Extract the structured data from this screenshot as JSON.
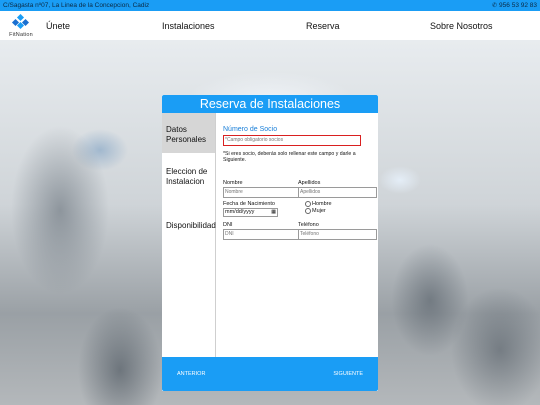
{
  "topbar": {
    "address": "C/Sagasta nº07, La Linea de la Concepcion, Cadiz",
    "phone": "956 53 92 83",
    "phone_icon": "phone-icon"
  },
  "brand": {
    "name": "FitNation",
    "logo_icon": "fitnation-logo-icon"
  },
  "nav": {
    "items": [
      "Únete",
      "Instalaciones",
      "Reserva",
      "Sobre Nosotros"
    ]
  },
  "card": {
    "title": "Reserva de Instalaciones",
    "steps": [
      {
        "label": "Datos Personales",
        "active": true
      },
      {
        "label": "Eleccion de Instalacion",
        "active": false
      },
      {
        "label": "Disponibilidad",
        "active": false
      }
    ],
    "form": {
      "socio_label": "Número de Socio",
      "socio_placeholder": "*Campo obligatorio socios",
      "socio_note": "*Si eres socio, deberás solo rellenar este campo y darle a Siguiente.",
      "nombre_label": "Nombre",
      "nombre_placeholder": "Nombre",
      "apellidos_label": "Apellidos",
      "apellidos_placeholder": "Apellidos",
      "fecha_label": "Fecha de Nacimiento",
      "fecha_placeholder": "mm/dd/yyyy",
      "gender_options": [
        "Hombre",
        "Mujer"
      ],
      "dni_label": "DNI",
      "dni_placeholder": "DNI",
      "telefono_label": "Teléfono",
      "telefono_placeholder": "Teléfono"
    },
    "footer": {
      "prev_label": "ANTERIOR",
      "next_label": "SIGUIENTE"
    }
  },
  "colors": {
    "accent": "#1a9df5",
    "required": "#d92020",
    "label_blue": "#1a7fd8"
  }
}
